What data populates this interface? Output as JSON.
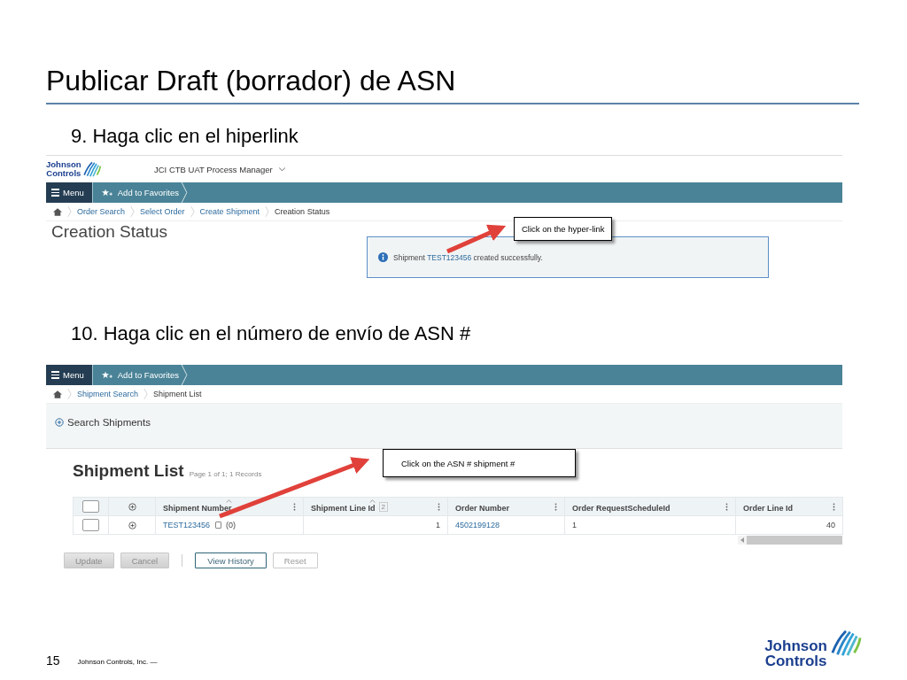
{
  "slide": {
    "title": "Publicar Draft (borrador) de ASN",
    "page_number": "15",
    "footer": "Johnson Controls, Inc. —",
    "logo": {
      "line_1": "Johnson",
      "line_2": "Controls"
    }
  },
  "steps": [
    {
      "text": "9. Haga clic en el hiperlink"
    },
    {
      "text": "10. Haga clic en el número de envío de ASN #"
    }
  ],
  "screen_1": {
    "logo": {
      "line_1": "Johnson",
      "line_2": "Controls"
    },
    "app_name": "JCI CTB UAT Process Manager",
    "menu": "Menu",
    "favorites": "Add to Favorites",
    "breadcrumbs": [
      {
        "label": "Order Search",
        "link": true
      },
      {
        "label": "Select Order",
        "link": true
      },
      {
        "label": "Create Shipment",
        "link": true
      },
      {
        "label": "Creation Status",
        "link": false
      }
    ],
    "heading": "Creation Status",
    "message": {
      "before": "Shipment",
      "link": "TEST123456",
      "after": "created successfully."
    },
    "callout": "Click on the hyper-link"
  },
  "screen_2": {
    "menu": "Menu",
    "favorites": "Add to Favorites",
    "breadcrumbs": [
      {
        "label": "Shipment Search",
        "link": true
      },
      {
        "label": "Shipment List",
        "link": false
      }
    ],
    "search_panel": "Search Shipments",
    "heading": "Shipment List",
    "record_info": "Page 1 of 1; 1 Records",
    "callout": "Click on the ASN # shipment #",
    "table": {
      "select_all_checked": false,
      "columns": [
        {
          "label": "Shipment Number",
          "kind": "link",
          "sorted": true
        },
        {
          "label": "Shipment Line Id",
          "kind": "number",
          "sorted": true,
          "sort_order": "2"
        },
        {
          "label": "Order Number",
          "kind": "link",
          "sorted": false
        },
        {
          "label": "Order RequestScheduleId",
          "kind": "text",
          "sorted": false
        },
        {
          "label": "Order Line Id",
          "kind": "number",
          "sorted": false
        }
      ],
      "rows": [
        {
          "checked": false,
          "cells": [
            "TEST123456",
            "1",
            "4502199128",
            "1",
            "40"
          ],
          "count": "(0)"
        }
      ]
    },
    "buttons": [
      {
        "label": "Update",
        "kind": "disabled"
      },
      {
        "label": "Cancel",
        "kind": "disabled"
      },
      {
        "label": "View History",
        "kind": "outline"
      },
      {
        "label": "Reset",
        "kind": "plain"
      }
    ]
  }
}
